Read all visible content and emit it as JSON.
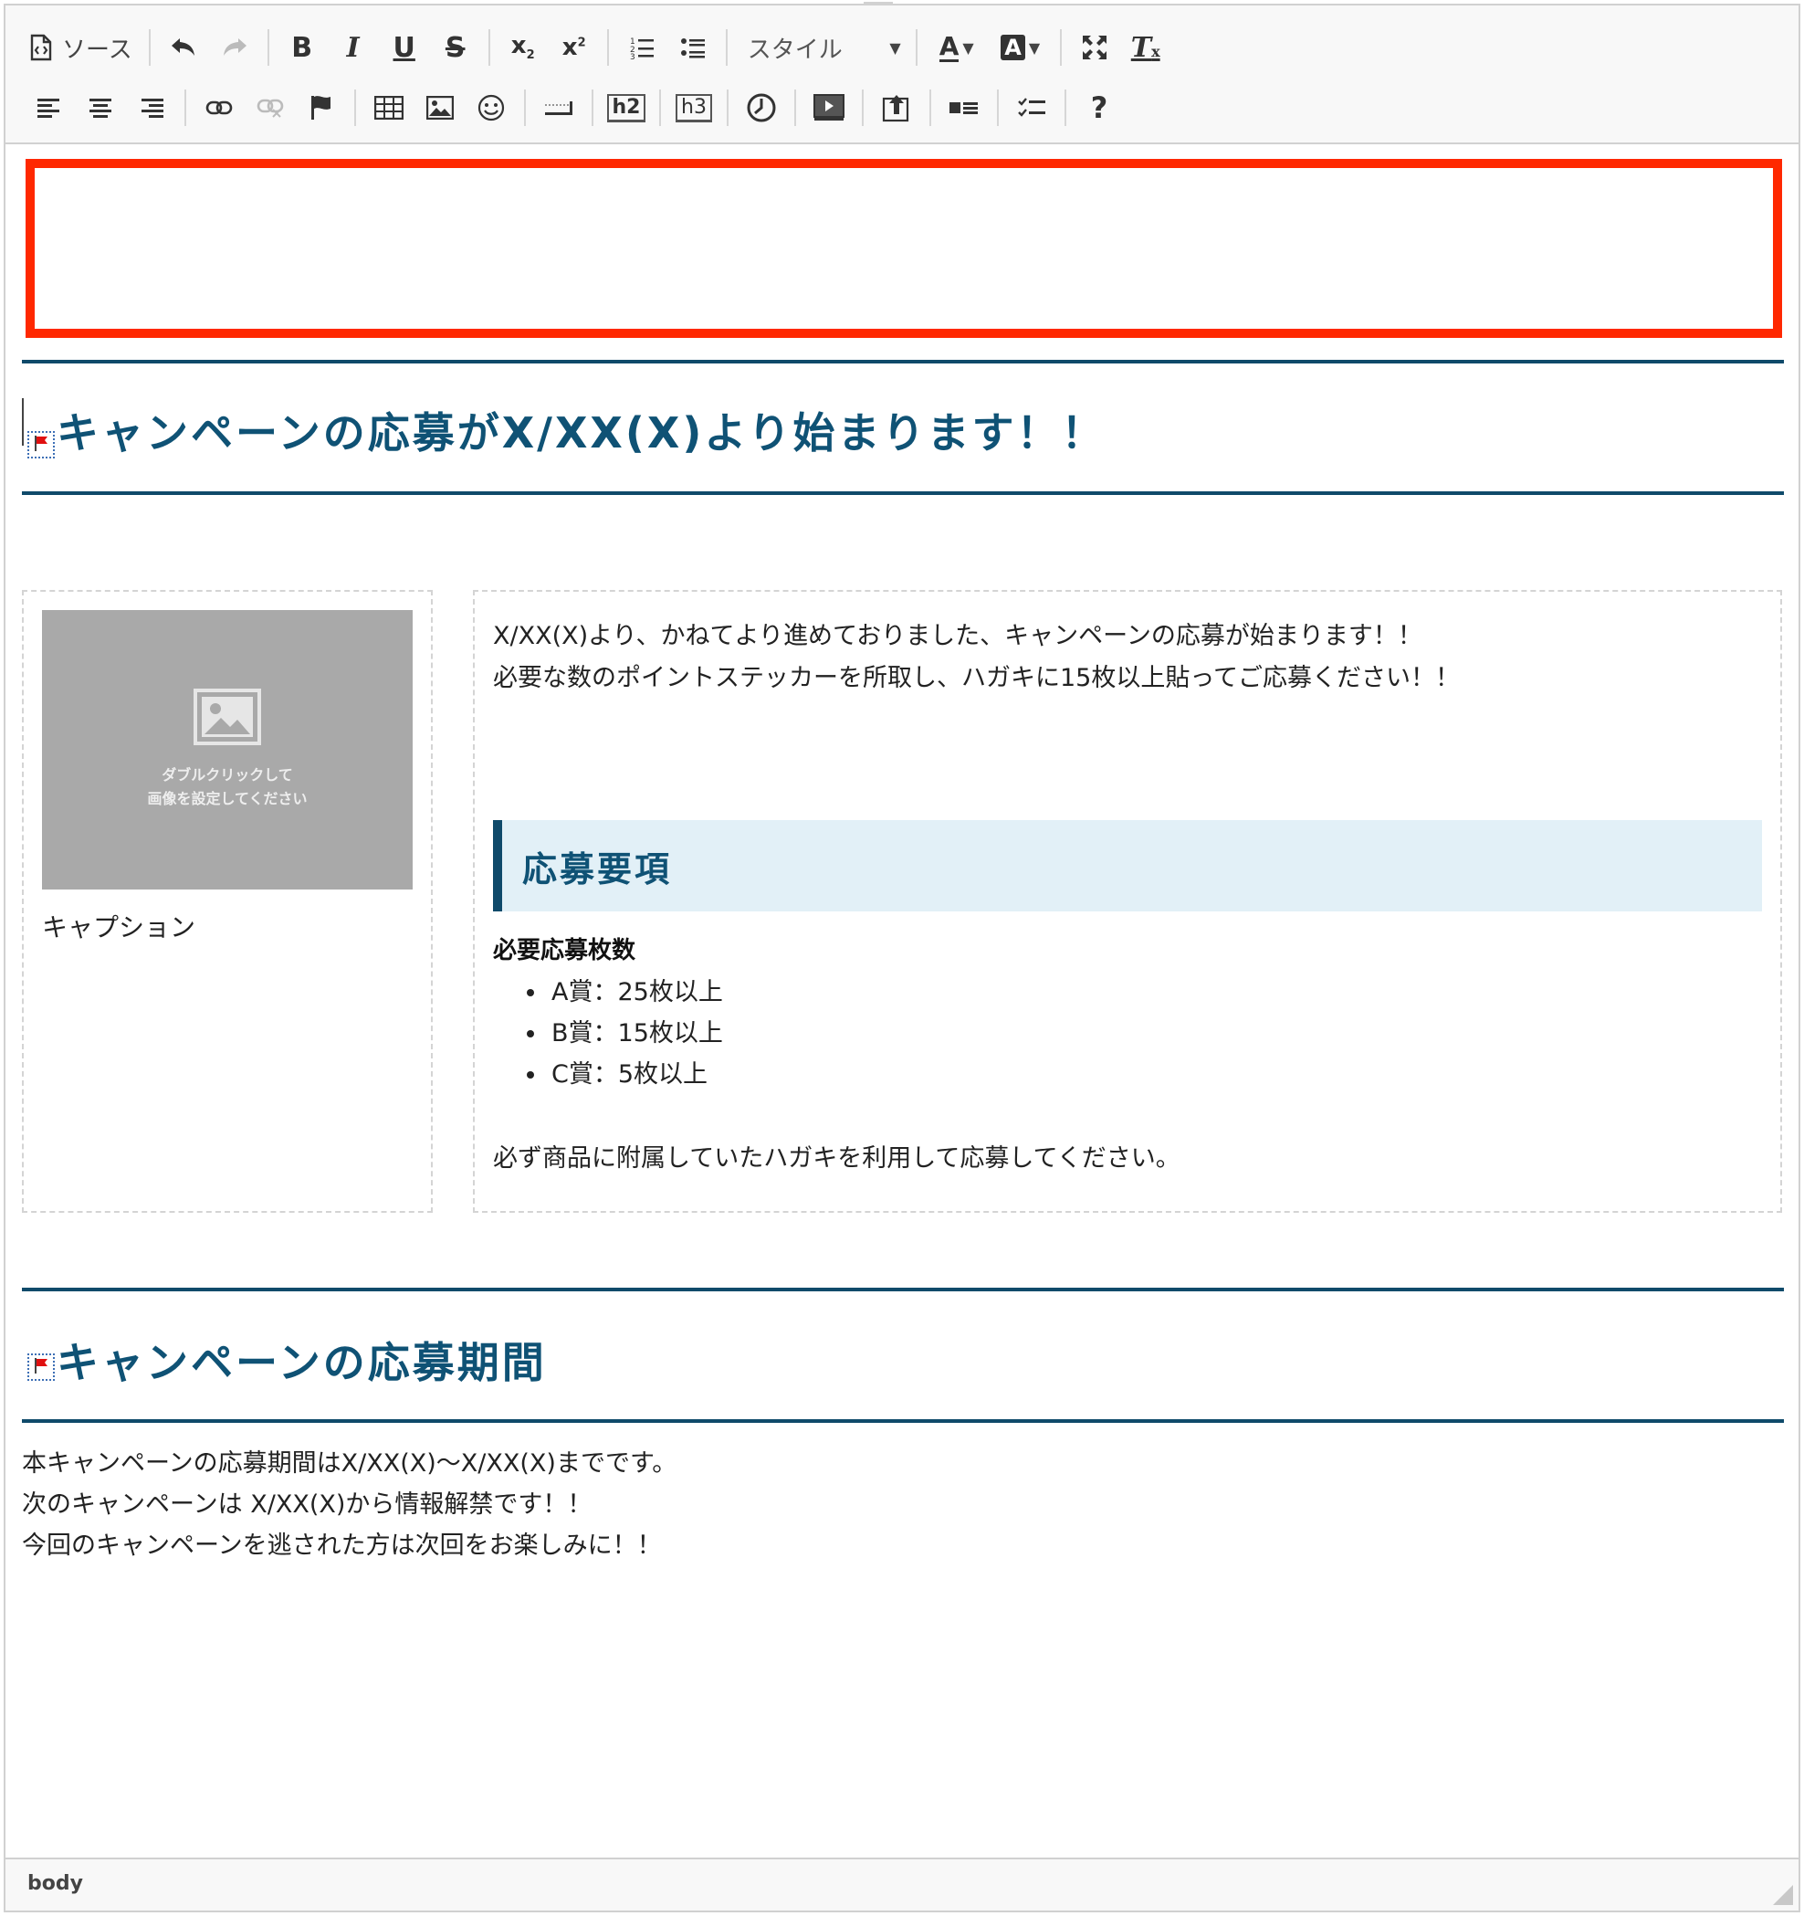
{
  "toolbar": {
    "source_label": "ソース",
    "style_label": "スタイル",
    "h2_label": "h2",
    "h3_label": "h3",
    "help_label": "?",
    "icons_row1": [
      "source-icon",
      "undo-icon",
      "redo-icon",
      "bold-icon",
      "italic-icon",
      "underline-icon",
      "strikethrough-icon",
      "subscript-icon",
      "superscript-icon",
      "numbered-list-icon",
      "bulleted-list-icon",
      "style-dropdown",
      "text-color-icon",
      "background-color-icon",
      "maximize-icon",
      "remove-format-icon"
    ],
    "icons_row2": [
      "align-left-icon",
      "align-center-icon",
      "align-right-icon",
      "link-icon",
      "unlink-icon",
      "anchor-flag-icon",
      "table-icon",
      "image-icon",
      "smiley-icon",
      "horizontal-rule-icon",
      "h2-icon",
      "h3-icon",
      "clock-icon",
      "video-icon",
      "upload-icon",
      "block-list-icon",
      "checklist-icon",
      "help-icon"
    ]
  },
  "colors": {
    "accent": "#0f4a6a",
    "heading": "#0f5275",
    "highlight_box": "#ff2800",
    "subheading_bg": "#e2f0f7",
    "placeholder_bg": "#a9a9a9"
  },
  "content": {
    "heading1": "キャンペーンの応募がX/XX(X)より始まります！！",
    "image_placeholder": {
      "line1": "ダブルクリックして",
      "line2": "画像を設定してください"
    },
    "caption": "キャプション",
    "intro_line1": "X/XX(X)より、かねてより進めておりました、キャンペーンの応募が始まります！！",
    "intro_line2": "必要な数のポイントステッカーを所取し、ハガキに15枚以上貼ってご応募ください！！",
    "subheading": "応募要項",
    "required_title": "必要応募枚数",
    "prizes": [
      "A賞：25枚以上",
      "B賞：15枚以上",
      "C賞：5枚以上"
    ],
    "note": "必ず商品に附属していたハガキを利用して応募してください。",
    "heading2": "キャンペーンの応募期間",
    "period_line1": "本キャンペーンの応募期間はX/XX(X)〜X/XX(X)までです。",
    "period_line2": "次のキャンペーンは X/XX(X)から情報解禁です！！",
    "period_line3": "今回のキャンペーンを逃された方は次回をお楽しみに！！"
  },
  "statusbar": {
    "path": "body"
  }
}
